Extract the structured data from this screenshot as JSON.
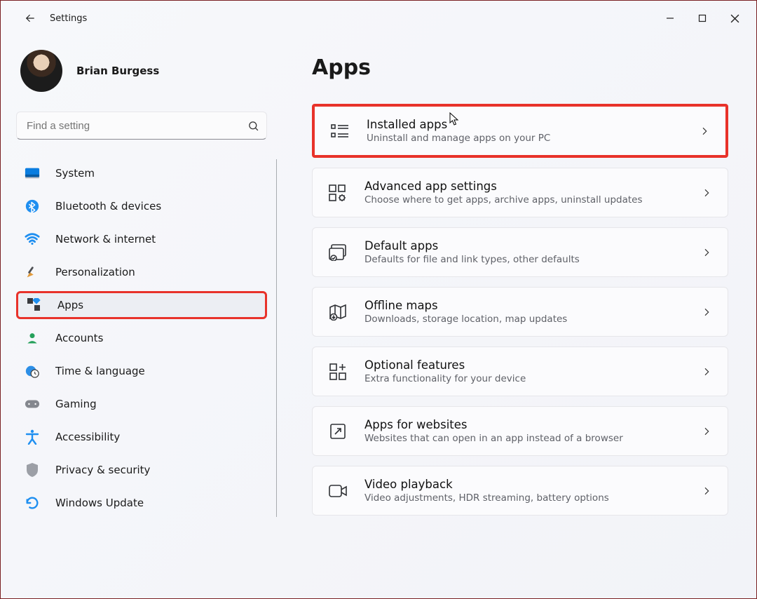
{
  "window": {
    "title": "Settings"
  },
  "profile": {
    "name": "Brian Burgess"
  },
  "search": {
    "placeholder": "Find a setting"
  },
  "sidebar": {
    "items": [
      {
        "label": "System"
      },
      {
        "label": "Bluetooth & devices"
      },
      {
        "label": "Network & internet"
      },
      {
        "label": "Personalization"
      },
      {
        "label": "Apps"
      },
      {
        "label": "Accounts"
      },
      {
        "label": "Time & language"
      },
      {
        "label": "Gaming"
      },
      {
        "label": "Accessibility"
      },
      {
        "label": "Privacy & security"
      },
      {
        "label": "Windows Update"
      }
    ]
  },
  "page": {
    "title": "Apps",
    "cards": [
      {
        "title": "Installed apps",
        "sub": "Uninstall and manage apps on your PC"
      },
      {
        "title": "Advanced app settings",
        "sub": "Choose where to get apps, archive apps, uninstall updates"
      },
      {
        "title": "Default apps",
        "sub": "Defaults for file and link types, other defaults"
      },
      {
        "title": "Offline maps",
        "sub": "Downloads, storage location, map updates"
      },
      {
        "title": "Optional features",
        "sub": "Extra functionality for your device"
      },
      {
        "title": "Apps for websites",
        "sub": "Websites that can open in an app instead of a browser"
      },
      {
        "title": "Video playback",
        "sub": "Video adjustments, HDR streaming, battery options"
      }
    ]
  }
}
